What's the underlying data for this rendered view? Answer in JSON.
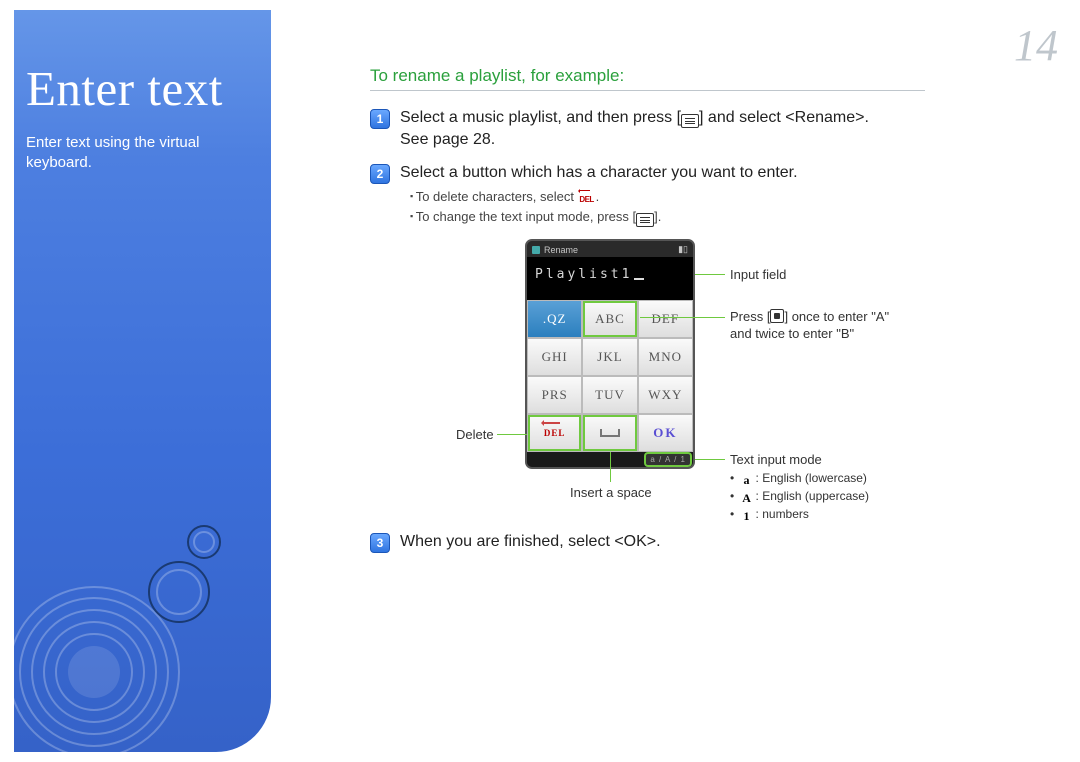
{
  "page_number": "14",
  "sidebar": {
    "title": "Enter text",
    "subtitle": "Enter text using the virtual keyboard."
  },
  "content": {
    "heading": "To rename a playlist, for example:",
    "steps": [
      {
        "num": "1",
        "text_a": "Select a music playlist, and then press [",
        "text_b": "] and select <Rename>.",
        "ref": "See page 28."
      },
      {
        "num": "2",
        "text": "Select a button which has a character you want to enter.",
        "bullets": {
          "b1a": "To delete characters, select ",
          "b1b": ".",
          "b2a": "To change the text input mode, press [",
          "b2b": "]."
        }
      },
      {
        "num": "3",
        "text": "When you are finished, select <OK>."
      }
    ]
  },
  "phone": {
    "header_title": "Rename",
    "input_value": "Playlist1",
    "keys": [
      ".QZ",
      "ABC",
      "DEF",
      "GHI",
      "JKL",
      "MNO",
      "PRS",
      "TUV",
      "WXY",
      "DEL",
      "␣",
      "OK"
    ],
    "mode_indicator": "a / A / 1"
  },
  "annotations": {
    "input_field": "Input field",
    "press_a": "Press [",
    "press_b": "] once to enter \"A\"",
    "press_c": "and twice to enter \"B\"",
    "delete": "Delete",
    "space": "Insert a space",
    "mode_title": "Text input mode",
    "mode_lower": ": English (lowercase)",
    "mode_upper": ": English (uppercase)",
    "mode_num": ": numbers"
  }
}
